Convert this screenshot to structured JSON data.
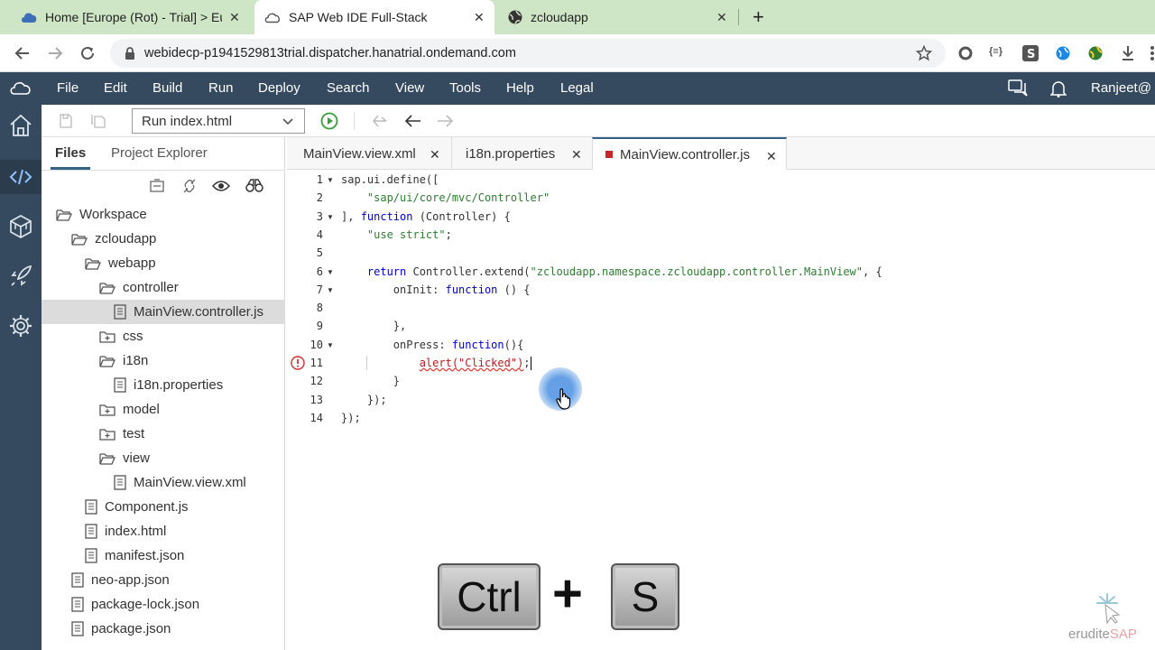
{
  "browser": {
    "tabs": [
      {
        "title": "Home [Europe (Rot) - Trial] > Eur",
        "close": "✕"
      },
      {
        "title": "SAP Web IDE Full-Stack",
        "close": "✕"
      },
      {
        "title": "zcloudapp",
        "close": "✕"
      }
    ],
    "new_tab": "+",
    "url": "webidecp-p1941529813trial.dispatcher.hanatrial.ondemand.com",
    "ext_braces": "{≡}"
  },
  "shell": {
    "menus": [
      "File",
      "Edit",
      "Build",
      "Run",
      "Deploy",
      "Search",
      "View",
      "Tools",
      "Help",
      "Legal"
    ],
    "user": "Ranjeet@"
  },
  "toolbar": {
    "run_config": "Run index.html"
  },
  "panel": {
    "tab_files": "Files",
    "tab_project_explorer": "Project Explorer"
  },
  "tree": [
    {
      "label": "Workspace",
      "type": "folder-open"
    },
    {
      "label": "zcloudapp",
      "type": "folder-open"
    },
    {
      "label": "webapp",
      "type": "folder-open"
    },
    {
      "label": "controller",
      "type": "folder-open"
    },
    {
      "label": "MainView.controller.js",
      "type": "file",
      "selected": true
    },
    {
      "label": "css",
      "type": "folder-closed"
    },
    {
      "label": "i18n",
      "type": "folder-open"
    },
    {
      "label": "i18n.properties",
      "type": "file"
    },
    {
      "label": "model",
      "type": "folder-closed"
    },
    {
      "label": "test",
      "type": "folder-closed"
    },
    {
      "label": "view",
      "type": "folder-open"
    },
    {
      "label": "MainView.view.xml",
      "type": "file"
    },
    {
      "label": "Component.js",
      "type": "file"
    },
    {
      "label": "index.html",
      "type": "file"
    },
    {
      "label": "manifest.json",
      "type": "file"
    },
    {
      "label": "neo-app.json",
      "type": "file"
    },
    {
      "label": "package-lock.json",
      "type": "file"
    },
    {
      "label": "package.json",
      "type": "file"
    }
  ],
  "editor": {
    "tabs": [
      {
        "title": "MainView.view.xml",
        "close": "✕"
      },
      {
        "title": "i18n.properties",
        "close": "✕"
      },
      {
        "title": "MainView.controller.js",
        "close": "✕",
        "active": true
      }
    ],
    "lines": [
      {
        "n": "1",
        "fold": true,
        "parts": [
          [
            "p",
            "sap.ui.define(["
          ]
        ]
      },
      {
        "n": "2",
        "parts": [
          [
            "p",
            "    "
          ],
          [
            "s",
            "\"sap/ui/core/mvc/Controller\""
          ]
        ]
      },
      {
        "n": "3",
        "fold": true,
        "parts": [
          [
            "p",
            "], "
          ],
          [
            "k",
            "function"
          ],
          [
            "p",
            " (Controller) {"
          ]
        ]
      },
      {
        "n": "4",
        "parts": [
          [
            "p",
            "    "
          ],
          [
            "s",
            "\"use strict\""
          ],
          [
            "p",
            ";"
          ]
        ]
      },
      {
        "n": "5",
        "parts": []
      },
      {
        "n": "6",
        "fold": true,
        "parts": [
          [
            "p",
            "    "
          ],
          [
            "k",
            "return"
          ],
          [
            "p",
            " Controller.extend("
          ],
          [
            "s",
            "\"zcloudapp.namespace.zcloudapp.controller.MainView\""
          ],
          [
            "p",
            ", {"
          ]
        ]
      },
      {
        "n": "7",
        "fold": true,
        "parts": [
          [
            "p",
            "        onInit: "
          ],
          [
            "k",
            "function"
          ],
          [
            "p",
            " () {"
          ]
        ]
      },
      {
        "n": "8",
        "parts": []
      },
      {
        "n": "9",
        "parts": [
          [
            "p",
            "        },"
          ]
        ]
      },
      {
        "n": "10",
        "fold": true,
        "parts": [
          [
            "p",
            "        onPress: "
          ],
          [
            "k",
            "function"
          ],
          [
            "p",
            "(){"
          ]
        ]
      },
      {
        "n": "11",
        "error": true,
        "parts": [
          [
            "p",
            "            "
          ],
          [
            "e",
            "alert(\"Clicked\")"
          ],
          [
            "p",
            ";"
          ]
        ]
      },
      {
        "n": "12",
        "parts": [
          [
            "p",
            "        }"
          ]
        ]
      },
      {
        "n": "13",
        "parts": [
          [
            "p",
            "    });"
          ]
        ]
      },
      {
        "n": "14",
        "parts": [
          [
            "p",
            "});"
          ]
        ]
      }
    ]
  },
  "overlay": {
    "key1": "Ctrl",
    "plus": "+",
    "key2": "S"
  },
  "watermark": {
    "part1": "erudite",
    "part2": "SAP"
  },
  "colors": {
    "shell": "#354a5f",
    "tabstrip": "#cfe6c6",
    "keyword": "#0000cc",
    "string": "#2e7d32",
    "error": "#e53935"
  }
}
